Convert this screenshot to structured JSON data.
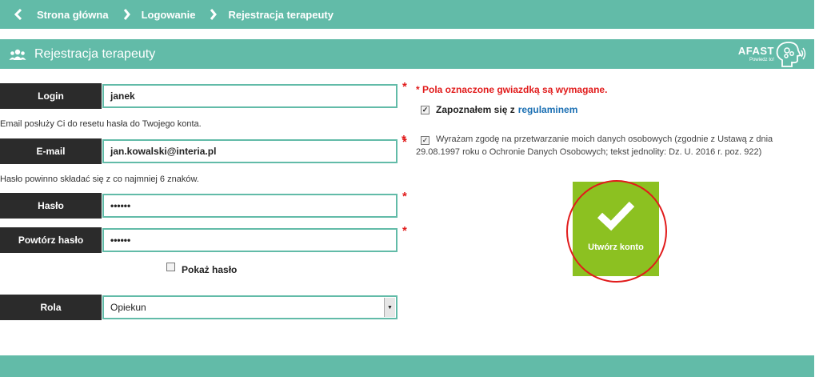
{
  "breadcrumb": {
    "items": [
      "Strona główna",
      "Logowanie",
      "Rejestracja terapeuty"
    ]
  },
  "section": {
    "title": "Rejestracja terapeuty",
    "logo_brand": "AFAST",
    "logo_sub": "Powiedz to!"
  },
  "form": {
    "login": {
      "label": "Login",
      "value": "janek"
    },
    "email_hint": "Email posłuży Ci do resetu hasła do Twojego konta.",
    "email": {
      "label": "E-mail",
      "value": "jan.kowalski@interia.pl"
    },
    "password_hint": "Hasło powinno składać się z co najmniej 6 znaków.",
    "password": {
      "label": "Hasło",
      "value": "••••••"
    },
    "password_repeat": {
      "label": "Powtórz hasło",
      "value": "••••••"
    },
    "show_password": {
      "label": "Pokaż hasło",
      "checked": false
    },
    "role": {
      "label": "Rola",
      "value": "Opiekun"
    },
    "required_star": "*"
  },
  "right": {
    "required_note": "* Pola oznaczone gwiazdką są wymagane.",
    "terms_prefix": "Zapoznałem się z",
    "terms_link": "regulaminem",
    "consent_text": "Wyrażam zgodę na przetwarzanie moich danych osobowych (zgodnie z Ustawą z dnia 29.08.1997 roku o Ochronie Danych Osobowych; tekst jednolity: Dz. U. 2016 r. poz. 922)",
    "create_button": "Utwórz konto"
  },
  "colors": {
    "accent": "#62bba8",
    "dark": "#2b2b2b",
    "button": "#8cc121",
    "required": "#e11b1b",
    "link": "#1a6fb3"
  }
}
